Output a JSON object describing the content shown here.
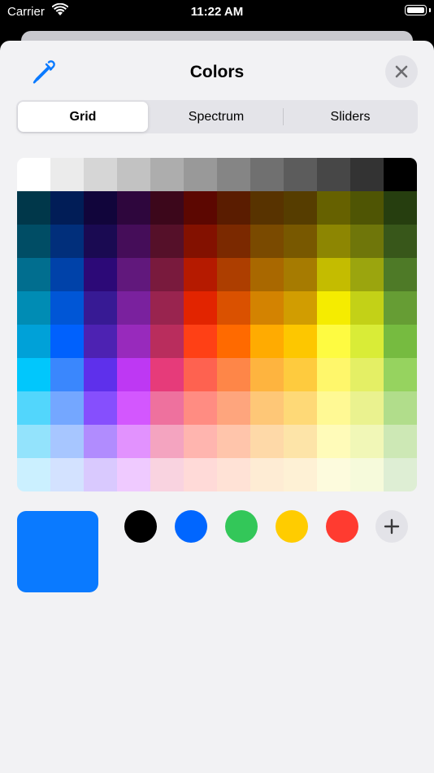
{
  "status_bar": {
    "carrier": "Carrier",
    "time": "11:22 AM"
  },
  "header": {
    "title": "Colors",
    "eyedropper_icon": "eyedropper-icon",
    "close_icon": "close-icon"
  },
  "tabs": [
    {
      "label": "Grid",
      "selected": true
    },
    {
      "label": "Spectrum",
      "selected": false
    },
    {
      "label": "Sliders",
      "selected": false
    }
  ],
  "grid_colors": [
    [
      "#ffffff",
      "#ebebeb",
      "#d6d6d6",
      "#c2c2c2",
      "#adadad",
      "#999999",
      "#858585",
      "#707070",
      "#5c5c5c",
      "#474747",
      "#333333",
      "#000000"
    ],
    [
      "#00374a",
      "#011d57",
      "#11053b",
      "#2e063d",
      "#3c071b",
      "#5c0701",
      "#5a1c00",
      "#583300",
      "#563d00",
      "#666100",
      "#4f5504",
      "#263e0f"
    ],
    [
      "#004d65",
      "#012f7b",
      "#1a0a52",
      "#450d59",
      "#551029",
      "#831100",
      "#7b2900",
      "#7a4a00",
      "#785800",
      "#8d8602",
      "#6f760a",
      "#38571a"
    ],
    [
      "#016e8f",
      "#0042a9",
      "#2c0977",
      "#61187c",
      "#791a3d",
      "#b51a00",
      "#ad3e00",
      "#a96800",
      "#a67b01",
      "#c4bc00",
      "#9ba50e",
      "#4e7a27"
    ],
    [
      "#008cb4",
      "#0056d6",
      "#371a94",
      "#7a219e",
      "#99244f",
      "#e22400",
      "#da5100",
      "#d38301",
      "#d19d01",
      "#f5ec00",
      "#c3d117",
      "#669d34"
    ],
    [
      "#00a1d8",
      "#0061fd",
      "#4d22b2",
      "#982abc",
      "#b92d5d",
      "#ff4015",
      "#ff6a00",
      "#ffab01",
      "#fdc700",
      "#fefb41",
      "#d9ec37",
      "#76bb40"
    ],
    [
      "#01c7fc",
      "#3a87fd",
      "#5e30eb",
      "#be38f3",
      "#e63b7a",
      "#fe6250",
      "#fe8648",
      "#feb43f",
      "#fecb3e",
      "#fff76b",
      "#e4ef65",
      "#96d35f"
    ],
    [
      "#52d6fc",
      "#74a7ff",
      "#864ffd",
      "#d357fe",
      "#ee719e",
      "#ff8c82",
      "#fea57d",
      "#fec777",
      "#fed977",
      "#fff994",
      "#eaf28f",
      "#b1dd8b"
    ],
    [
      "#93e3fc",
      "#a7c6ff",
      "#b18cfe",
      "#e292fe",
      "#f4a4c0",
      "#ffb5af",
      "#ffc5ab",
      "#fed9a8",
      "#fde4a8",
      "#fffbb9",
      "#f1f7b7",
      "#cde8b5"
    ],
    [
      "#cbf0ff",
      "#d3e2ff",
      "#d9c9fe",
      "#efcaff",
      "#f9d3e0",
      "#ffdad8",
      "#ffe2d6",
      "#feecd4",
      "#fef1d5",
      "#fdfbdd",
      "#f6fadb",
      "#deeed4"
    ]
  ],
  "current_color": "#0a7aff",
  "recent_colors": [
    {
      "name": "black",
      "hex": "#000000"
    },
    {
      "name": "blue",
      "hex": "#0066ff"
    },
    {
      "name": "green",
      "hex": "#33c759"
    },
    {
      "name": "yellow",
      "hex": "#ffcc00"
    },
    {
      "name": "red",
      "hex": "#ff3b30"
    }
  ],
  "add_icon": "plus-icon",
  "accent_color": "#0a7aff"
}
